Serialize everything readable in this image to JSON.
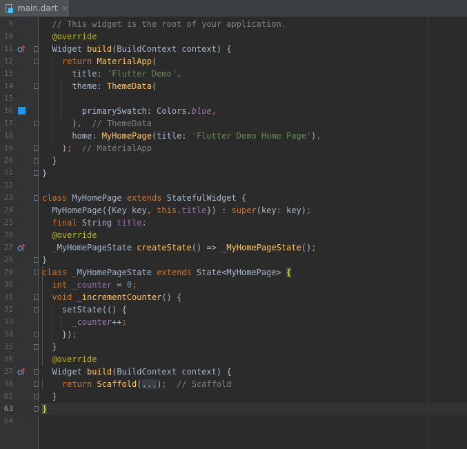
{
  "tab": {
    "label": "main.dart",
    "close": "×"
  },
  "colors": {
    "keyword": "#cc7832",
    "string": "#6a8759",
    "comment": "#808080",
    "annotation": "#bbb529",
    "function": "#ffc66d",
    "field": "#9876aa",
    "number": "#6897bb",
    "swatch": "#2196f3",
    "background": "#2b2b2b"
  },
  "lines": [
    {
      "n": "9",
      "tokens": [
        {
          "t": "  // This widget is the root of your application.",
          "c": "com"
        }
      ]
    },
    {
      "n": "10",
      "tokens": [
        {
          "t": "  "
        },
        {
          "t": "@override",
          "c": "ann"
        }
      ]
    },
    {
      "n": "11",
      "icon": "override-icon",
      "fold": true,
      "tokens": [
        {
          "t": "  Widget "
        },
        {
          "t": "build",
          "c": "fn"
        },
        {
          "t": "(BuildContext context) {"
        }
      ]
    },
    {
      "n": "12",
      "fold": true,
      "tokens": [
        {
          "t": "    "
        },
        {
          "t": "return ",
          "c": "kw"
        },
        {
          "t": "MaterialApp",
          "c": "fn"
        },
        {
          "t": "("
        }
      ]
    },
    {
      "n": "13",
      "tokens": [
        {
          "t": "      title: "
        },
        {
          "t": "'Flutter Demo'",
          "c": "str"
        },
        {
          "t": ",",
          "c": "kw"
        }
      ]
    },
    {
      "n": "14",
      "fold": true,
      "tokens": [
        {
          "t": "      theme: "
        },
        {
          "t": "ThemeData",
          "c": "fn"
        },
        {
          "t": "("
        }
      ]
    },
    {
      "n": "15",
      "tokens": [
        {
          "t": ""
        }
      ]
    },
    {
      "n": "16",
      "swatch": true,
      "tokens": [
        {
          "t": "        primarySwatch: Colors."
        },
        {
          "t": "blue",
          "c": "cst"
        },
        {
          "t": ",",
          "c": "kw"
        }
      ]
    },
    {
      "n": "17",
      "fold": true,
      "tokens": [
        {
          "t": "      )"
        },
        {
          "t": ",",
          "c": "kw"
        },
        {
          "t": "  "
        },
        {
          "t": "// ThemeData",
          "c": "com"
        }
      ]
    },
    {
      "n": "18",
      "tokens": [
        {
          "t": "      home: "
        },
        {
          "t": "MyHomePage",
          "c": "fn"
        },
        {
          "t": "(title: "
        },
        {
          "t": "'Flutter Demo Home Page'",
          "c": "str"
        },
        {
          "t": ")"
        },
        {
          "t": ",",
          "c": "kw"
        }
      ]
    },
    {
      "n": "19",
      "fold": true,
      "tokens": [
        {
          "t": "    )"
        },
        {
          "t": ";",
          "c": "kw"
        },
        {
          "t": "  "
        },
        {
          "t": "// MaterialApp",
          "c": "com"
        }
      ]
    },
    {
      "n": "20",
      "fold": true,
      "tokens": [
        {
          "t": "  }"
        }
      ]
    },
    {
      "n": "21",
      "fold": true,
      "tokens": [
        {
          "t": "}"
        }
      ]
    },
    {
      "n": "22",
      "tokens": [
        {
          "t": ""
        }
      ]
    },
    {
      "n": "23",
      "fold": true,
      "tokens": [
        {
          "t": "class ",
          "c": "kw"
        },
        {
          "t": "MyHomePage "
        },
        {
          "t": "extends ",
          "c": "kw"
        },
        {
          "t": "StatefulWidget {"
        }
      ]
    },
    {
      "n": "24",
      "tokens": [
        {
          "t": "  MyHomePage({Key key"
        },
        {
          "t": ", ",
          "c": "kw"
        },
        {
          "t": "this",
          "c": "kw"
        },
        {
          "t": "."
        },
        {
          "t": "title",
          "c": "fld"
        },
        {
          "t": "}) : "
        },
        {
          "t": "super",
          "c": "kw"
        },
        {
          "t": "(key: key)"
        },
        {
          "t": ";",
          "c": "kw"
        }
      ]
    },
    {
      "n": "25",
      "tokens": [
        {
          "t": "  "
        },
        {
          "t": "final ",
          "c": "kw"
        },
        {
          "t": "String "
        },
        {
          "t": "title",
          "c": "fld"
        },
        {
          "t": ";",
          "c": "kw"
        }
      ]
    },
    {
      "n": "26",
      "tokens": [
        {
          "t": "  "
        },
        {
          "t": "@override",
          "c": "ann"
        }
      ]
    },
    {
      "n": "27",
      "icon": "override-icon",
      "tokens": [
        {
          "t": "  _MyHomePageState "
        },
        {
          "t": "createState",
          "c": "fn"
        },
        {
          "t": "() => "
        },
        {
          "t": "_MyHomePageState",
          "c": "fn"
        },
        {
          "t": "()"
        },
        {
          "t": ";",
          "c": "kw"
        }
      ]
    },
    {
      "n": "28",
      "fold": true,
      "tokens": [
        {
          "t": "}"
        }
      ]
    },
    {
      "n": "29",
      "fold": true,
      "tokens": [
        {
          "t": "class ",
          "c": "kw"
        },
        {
          "t": "_MyHomePageState "
        },
        {
          "t": "extends ",
          "c": "kw"
        },
        {
          "t": "State<MyHomePage> "
        },
        {
          "t": "{",
          "c": "brace"
        }
      ]
    },
    {
      "n": "30",
      "tokens": [
        {
          "t": "  "
        },
        {
          "t": "int ",
          "c": "kw"
        },
        {
          "t": "_counter",
          "c": "fld"
        },
        {
          "t": " = "
        },
        {
          "t": "0",
          "c": "num"
        },
        {
          "t": ";",
          "c": "kw"
        }
      ]
    },
    {
      "n": "31",
      "fold": true,
      "tokens": [
        {
          "t": "  "
        },
        {
          "t": "void ",
          "c": "kw"
        },
        {
          "t": "_incrementCounter",
          "c": "fn"
        },
        {
          "t": "() {"
        }
      ]
    },
    {
      "n": "32",
      "fold": true,
      "tokens": [
        {
          "t": "    setState(() {"
        }
      ]
    },
    {
      "n": "33",
      "tokens": [
        {
          "t": "      "
        },
        {
          "t": "_counter",
          "c": "fld"
        },
        {
          "t": "++"
        },
        {
          "t": ";",
          "c": "kw"
        }
      ]
    },
    {
      "n": "34",
      "fold": true,
      "tokens": [
        {
          "t": "    })"
        },
        {
          "t": ";",
          "c": "kw"
        }
      ]
    },
    {
      "n": "35",
      "fold": true,
      "tokens": [
        {
          "t": "  }"
        }
      ]
    },
    {
      "n": "36",
      "tokens": [
        {
          "t": "  "
        },
        {
          "t": "@override",
          "c": "ann"
        }
      ]
    },
    {
      "n": "37",
      "icon": "override-icon",
      "fold": true,
      "tokens": [
        {
          "t": "  Widget "
        },
        {
          "t": "build",
          "c": "fn"
        },
        {
          "t": "(BuildContext context) {"
        }
      ]
    },
    {
      "n": "38",
      "fold": true,
      "tokens": [
        {
          "t": "    "
        },
        {
          "t": "return ",
          "c": "kw"
        },
        {
          "t": "Scaffold",
          "c": "fn"
        },
        {
          "t": "("
        },
        {
          "t": "...",
          "c": "fold"
        },
        {
          "t": ")"
        },
        {
          "t": ";",
          "c": "kw"
        },
        {
          "t": "  "
        },
        {
          "t": "// Scaffold",
          "c": "com"
        }
      ]
    },
    {
      "n": "62",
      "fold": true,
      "tokens": [
        {
          "t": "  }"
        }
      ]
    },
    {
      "n": "63",
      "current": true,
      "fold": true,
      "tokens": [
        {
          "t": "}",
          "c": "brace"
        }
      ]
    },
    {
      "n": "64",
      "tokens": [
        {
          "t": ""
        }
      ]
    }
  ]
}
